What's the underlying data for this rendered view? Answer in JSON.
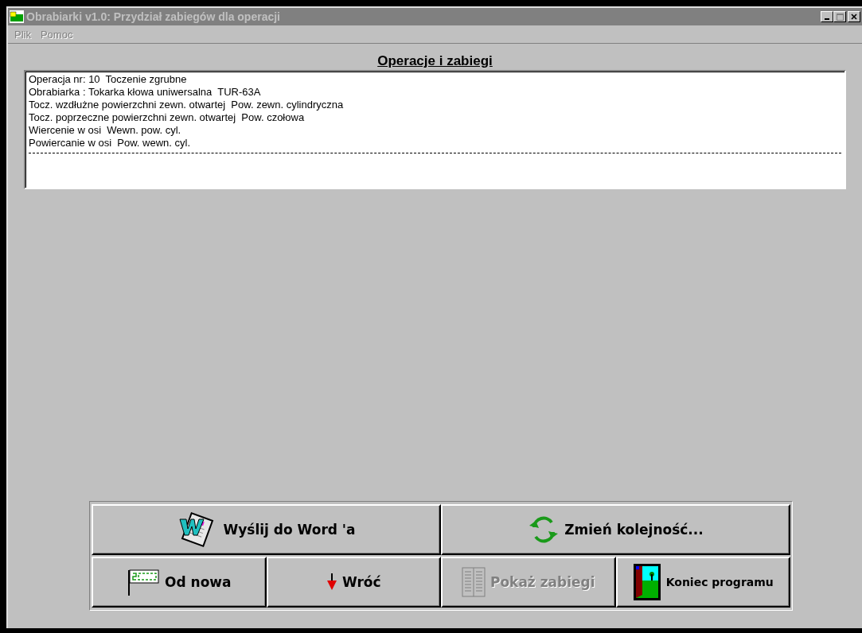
{
  "window": {
    "title": "Obrabiarki v1.0: Przydział zabiegów dla operacji",
    "active": false
  },
  "menu": [
    {
      "label": "Plik",
      "disabled": true
    },
    {
      "label": "Pomoc",
      "disabled": true
    }
  ],
  "heading": "Operacje i zabiegi",
  "list": [
    "Operacja nr: 10  Toczenie zgrubne",
    "Obrabiarka : Tokarka kłowa uniwersalna  TUR-63A",
    "Tocz. wzdłużne powierzchni zewn. otwartej  Pow. zewn. cylindryczna",
    "Tocz. poprzeczne powierzchni zewn. otwartej  Pow. czołowa",
    "Wiercenie w osi  Wewn. pow. cyl.",
    "Powiercanie w osi  Pow. wewn. cyl."
  ],
  "buttons": [
    [
      {
        "kind": "word",
        "label": "Wyślij do Word 'a",
        "disabled": false
      },
      {
        "kind": "cycle",
        "label": "Zmień kolejność...",
        "disabled": false
      }
    ],
    [
      {
        "kind": "start",
        "label": "Od nowa",
        "disabled": false
      },
      {
        "kind": "down",
        "label": "Wróć",
        "disabled": false
      },
      {
        "kind": "list",
        "label": "Pokaż zabiegi",
        "disabled": true
      },
      {
        "kind": "exit",
        "label": "Koniec programu",
        "disabled": false
      }
    ]
  ]
}
